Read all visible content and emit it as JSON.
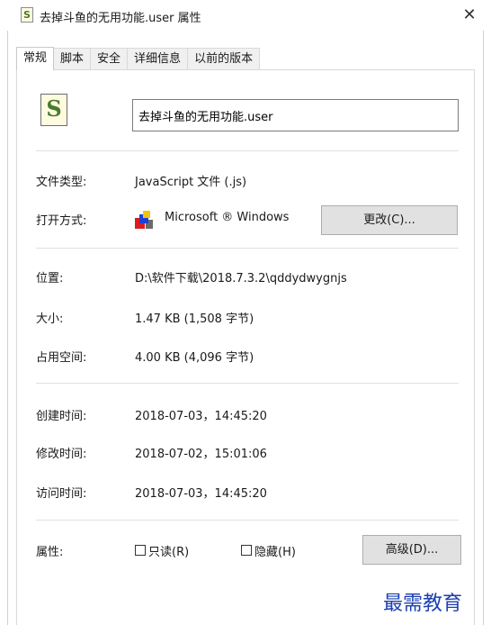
{
  "window": {
    "title": "去掉斗鱼的无用功能.user 属性",
    "close_glyph": "✕"
  },
  "tabs": [
    {
      "label": "常规",
      "active": true
    },
    {
      "label": "脚本",
      "active": false
    },
    {
      "label": "安全",
      "active": false
    },
    {
      "label": "详细信息",
      "active": false
    },
    {
      "label": "以前的版本",
      "active": false
    }
  ],
  "general": {
    "file_name": "去掉斗鱼的无用功能.user",
    "file_type_label": "文件类型:",
    "file_type_value": "JavaScript 文件 (.js)",
    "opens_with_label": "打开方式:",
    "opens_with_value": "Microsoft ® Windows",
    "change_button": "更改(C)...",
    "location_label": "位置:",
    "location_value": "D:\\软件下载\\2018.7.3.2\\qddydwygnjs",
    "size_label": "大小:",
    "size_value": "1.47 KB (1,508 字节)",
    "size_on_disk_label": "占用空间:",
    "size_on_disk_value": "4.00 KB (4,096 字节)",
    "created_label": "创建时间:",
    "created_value": "2018-07-03，14:45:20",
    "modified_label": "修改时间:",
    "modified_value": "2018-07-02，15:01:06",
    "accessed_label": "访问时间:",
    "accessed_value": "2018-07-03，14:45:20",
    "attributes_label": "属性:",
    "readonly_label": "只读(R)",
    "hidden_label": "隐藏(H)",
    "advanced_button": "高级(D)..."
  },
  "icons": {
    "title": "script-file-icon",
    "file": "script-file-icon",
    "program": "windows-program-icon"
  },
  "watermark": "最需教育"
}
